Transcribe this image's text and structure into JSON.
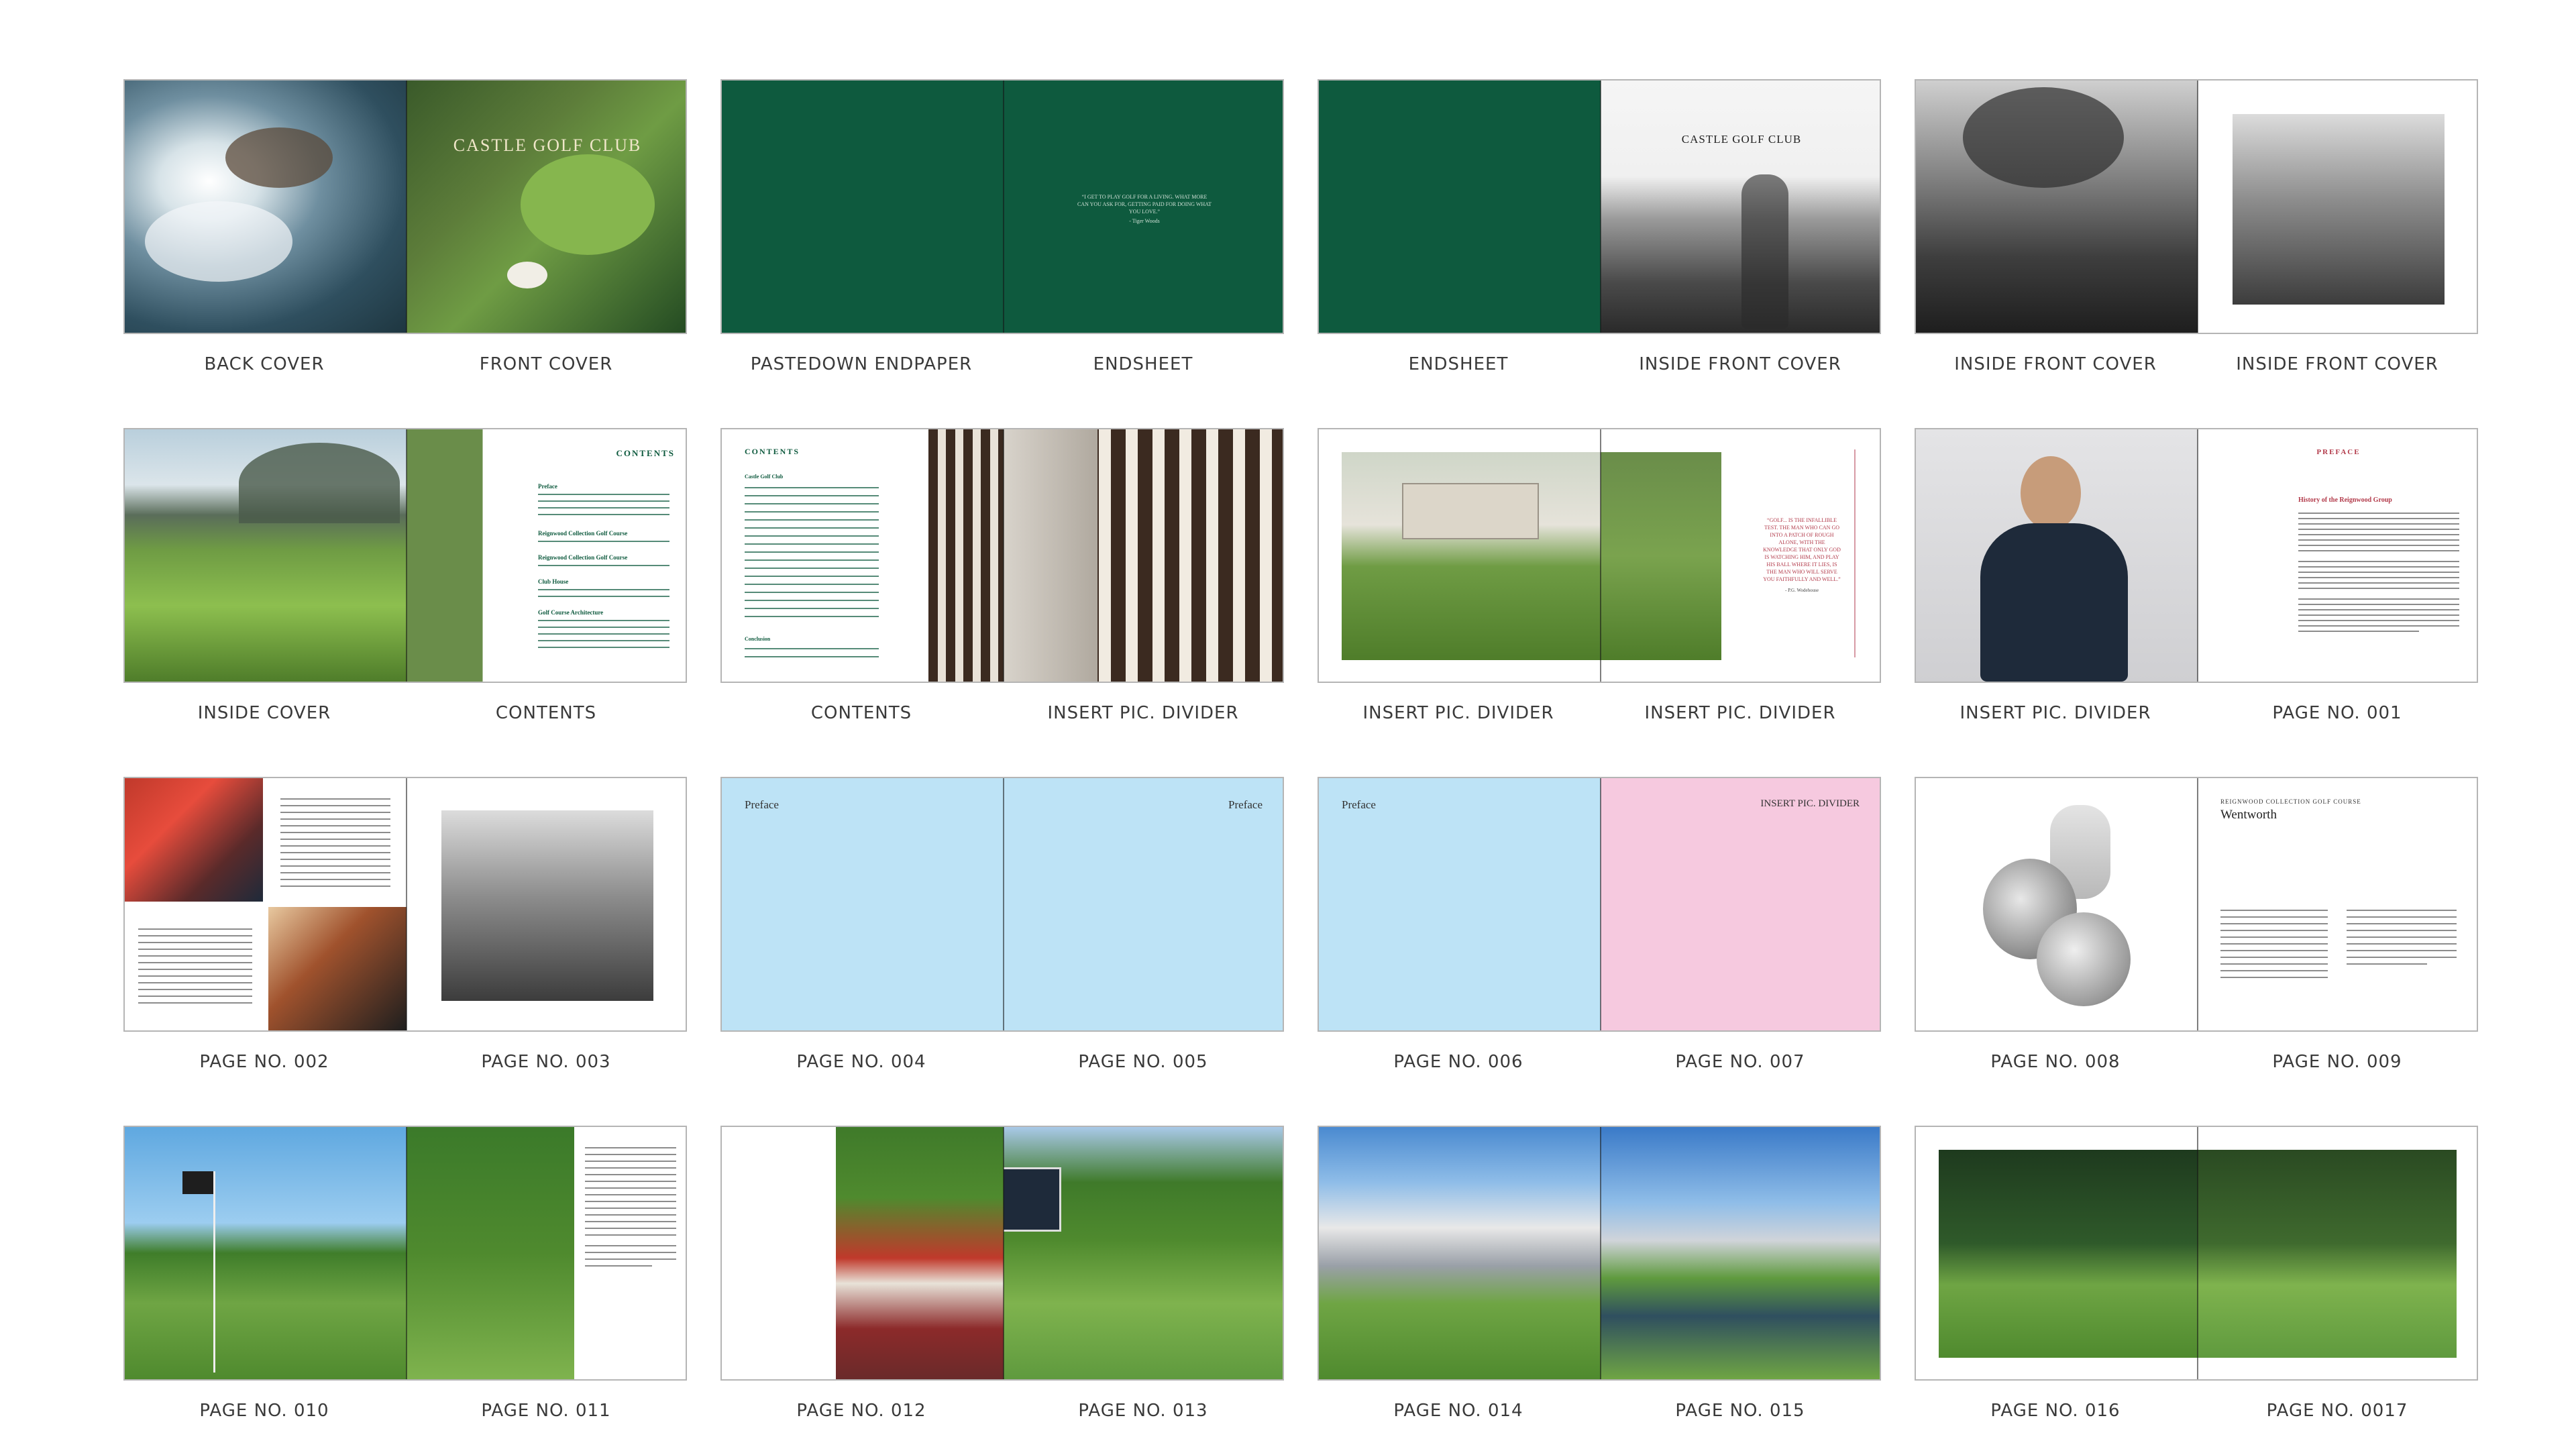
{
  "captions": [
    "BACK COVER",
    "FRONT COVER",
    "PASTEDOWN ENDPAPER",
    "ENDSHEET",
    "ENDSHEET",
    "INSIDE FRONT COVER",
    "INSIDE FRONT COVER",
    "INSIDE FRONT COVER",
    "INSIDE COVER",
    "CONTENTS",
    "CONTENTS",
    "INSERT PIC. DIVIDER",
    "INSERT PIC. DIVIDER",
    "INSERT PIC. DIVIDER",
    "INSERT PIC. DIVIDER",
    "PAGE NO. 001",
    "PAGE NO. 002",
    "PAGE NO. 003",
    "PAGE NO. 004",
    "PAGE NO. 005",
    "PAGE NO. 006",
    "PAGE NO. 007",
    "PAGE NO. 008",
    "PAGE NO. 009",
    "PAGE NO. 010",
    "PAGE NO. 011",
    "PAGE NO. 012",
    "PAGE NO. 013",
    "PAGE NO. 014",
    "PAGE NO. 015",
    "PAGE NO. 016",
    "PAGE NO. 0017"
  ],
  "pages": {
    "front_cover_title": "CASTLE GOLF CLUB",
    "endsheet_quote": "“I GET TO PLAY GOLF FOR A LIVING. WHAT MORE CAN YOU ASK FOR, GETTING PAID FOR DOING WHAT YOU LOVE.”",
    "endsheet_quote_author": "- Tiger Woods",
    "inside_front_title": "CASTLE GOLF CLUB",
    "contents_heading": "CONTENTS",
    "contents_sections": [
      "Preface",
      "Reignwood Collection Golf Course",
      "Reignwood Collection Golf Course",
      "Club House",
      "Golf Course Architecture"
    ],
    "contents_left_heading": "CONTENTS",
    "contents_left_subheading": "Castle Golf Club",
    "contents_left_footer": "Conclusion",
    "divider_quote": "“GOLF... IS THE INFALLIBLE TEST. THE MAN WHO CAN GO INTO A PATCH OF ROUGH ALONE, WITH THE KNOWLEDGE THAT ONLY GOD IS WATCHING HIM, AND PLAY HIS BALL WHERE IT LIES, IS THE MAN WHO WILL SERVE YOU FAITHFULLY AND WELL.”",
    "divider_quote_author": "- P.G. Wodehouse",
    "preface_heading": "PREFACE",
    "preface_title": "History of the Reignwood Group",
    "page004_label": "Preface",
    "page005_label": "Preface",
    "page006_label": "Preface",
    "page007_label": "INSERT PIC. DIVIDER",
    "page009_kicker": "REIGNWOOD COLLECTION GOLF COURSE",
    "page009_title": "Wentworth"
  },
  "colors": {
    "endpaper_green": "#0e5a3e",
    "preface_blue": "#bde3f6",
    "divider_pink": "#f6c9df",
    "quote_red": "#b23a4a",
    "caption_grey": "#3a3a3a"
  }
}
